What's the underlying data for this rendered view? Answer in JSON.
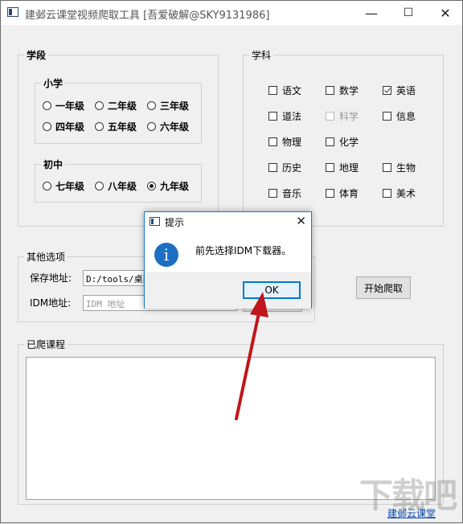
{
  "window": {
    "title": "建邺云课堂视频爬取工具 [吾爱破解@SKY9131986]",
    "minimize": "—",
    "maximize": "☐",
    "close": "✕"
  },
  "grade": {
    "title": "学段",
    "primary_title": "小学",
    "primary": [
      "一年级",
      "二年级",
      "三年级",
      "四年级",
      "五年级",
      "六年级"
    ],
    "middle_title": "初中",
    "middle": [
      "七年级",
      "八年级",
      "九年级"
    ],
    "selected": "九年级"
  },
  "subject": {
    "title": "学科",
    "items": [
      {
        "label": "语文",
        "checked": false,
        "disabled": false
      },
      {
        "label": "数学",
        "checked": false,
        "disabled": false
      },
      {
        "label": "英语",
        "checked": true,
        "disabled": false
      },
      {
        "label": "道法",
        "checked": false,
        "disabled": false
      },
      {
        "label": "科学",
        "checked": false,
        "disabled": true
      },
      {
        "label": "信息",
        "checked": false,
        "disabled": false
      },
      {
        "label": "物理",
        "checked": false,
        "disabled": false
      },
      {
        "label": "化学",
        "checked": false,
        "disabled": false
      },
      {
        "label": "历史",
        "checked": false,
        "disabled": false
      },
      {
        "label": "地理",
        "checked": false,
        "disabled": false
      },
      {
        "label": "生物",
        "checked": false,
        "disabled": false
      },
      {
        "label": "音乐",
        "checked": false,
        "disabled": false
      },
      {
        "label": "体育",
        "checked": false,
        "disabled": false
      },
      {
        "label": "美术",
        "checked": false,
        "disabled": false
      }
    ]
  },
  "options": {
    "title": "其他选项",
    "save_label": "保存地址:",
    "save_value": "D:/tools/桌面",
    "idm_label": "IDM地址:",
    "idm_placeholder": "IDM 地址"
  },
  "start_button": "开始爬取",
  "courses": {
    "title": "已爬课程"
  },
  "footer_link": "建邺云课堂",
  "watermark": "下载吧",
  "dialog": {
    "title": "提示",
    "icon": "i",
    "message": "前先选择IDM下载器。",
    "ok": "OK",
    "close": "✕"
  },
  "colors": {
    "accent": "#0078d7",
    "info_icon": "#1d6fc2",
    "arrow": "#c0161b"
  }
}
